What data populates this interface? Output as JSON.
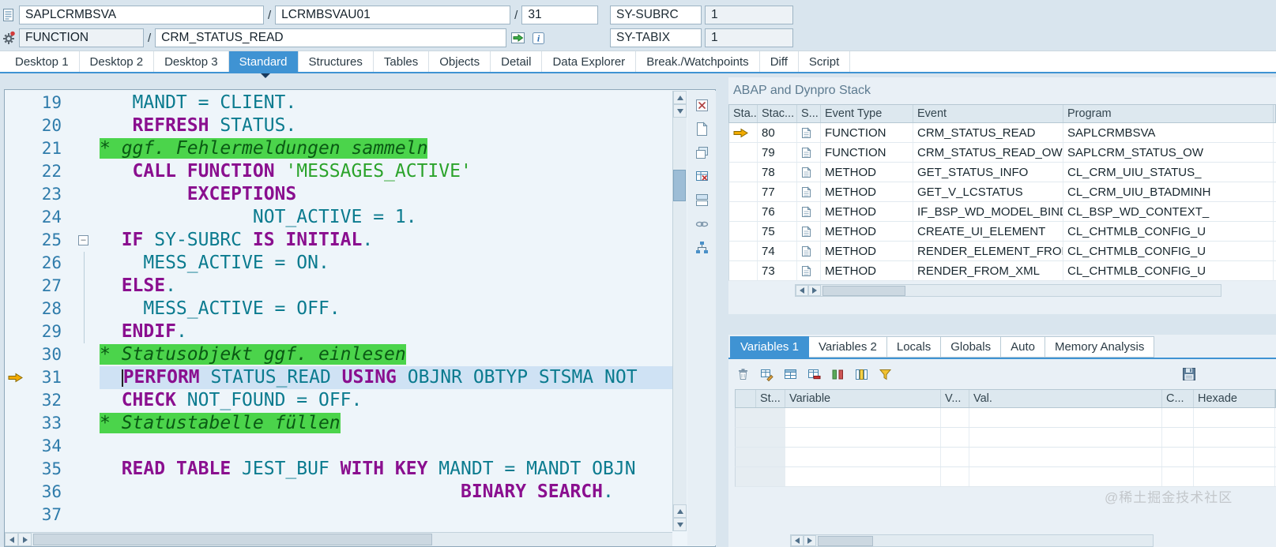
{
  "header": {
    "slash": "/",
    "main_program": "SAPLCRMBSVA",
    "include": "LCRMBSVAU01",
    "line_number": "31",
    "event_type": "FUNCTION",
    "event_name": "CRM_STATUS_READ",
    "sysvars": [
      {
        "label": "SY-SUBRC",
        "value": "1"
      },
      {
        "label": "SY-TABIX",
        "value": "1"
      }
    ]
  },
  "main_tabs": {
    "active": "Standard",
    "items": [
      "Desktop 1",
      "Desktop 2",
      "Desktop 3",
      "Standard",
      "Structures",
      "Tables",
      "Objects",
      "Detail",
      "Data Explorer",
      "Break./Watchpoints",
      "Diff",
      "Script"
    ]
  },
  "editor": {
    "tools": [
      "close-icon",
      "new-page-icon",
      "cascade-icon",
      "table-export-icon",
      "split-view-icon",
      "link-icon",
      "hierarchy-icon"
    ],
    "lines": [
      {
        "n": "19",
        "indent": 3,
        "tokens": [
          {
            "c": "id",
            "t": "MANDT = CLIENT."
          }
        ]
      },
      {
        "n": "20",
        "indent": 3,
        "tokens": [
          {
            "c": "kw",
            "t": "REFRESH"
          },
          {
            "c": "id",
            "t": " STATUS."
          }
        ]
      },
      {
        "n": "21",
        "indent": 0,
        "comment": "* ggf. Fehlermeldungen sammeln"
      },
      {
        "n": "22",
        "indent": 3,
        "tokens": [
          {
            "c": "kw",
            "t": "CALL FUNCTION"
          },
          {
            "c": "id",
            "t": " "
          },
          {
            "c": "str",
            "t": "'MESSAGES_ACTIVE'"
          }
        ]
      },
      {
        "n": "23",
        "indent": 8,
        "tokens": [
          {
            "c": "kw",
            "t": "EXCEPTIONS"
          }
        ]
      },
      {
        "n": "24",
        "indent": 14,
        "tokens": [
          {
            "c": "id",
            "t": "NOT_ACTIVE = 1."
          }
        ]
      },
      {
        "n": "25",
        "indent": 2,
        "fold": true,
        "tokens": [
          {
            "c": "kw",
            "t": "IF"
          },
          {
            "c": "id",
            "t": " SY-SUBRC "
          },
          {
            "c": "kw",
            "t": "IS INITIAL"
          },
          {
            "c": "id",
            "t": "."
          }
        ]
      },
      {
        "n": "26",
        "indent": 4,
        "foldline": true,
        "tokens": [
          {
            "c": "id",
            "t": "MESS_ACTIVE = ON."
          }
        ]
      },
      {
        "n": "27",
        "indent": 2,
        "foldline": true,
        "tokens": [
          {
            "c": "kw",
            "t": "ELSE"
          },
          {
            "c": "id",
            "t": "."
          }
        ]
      },
      {
        "n": "28",
        "indent": 4,
        "foldline": true,
        "tokens": [
          {
            "c": "id",
            "t": "MESS_ACTIVE = OFF."
          }
        ]
      },
      {
        "n": "29",
        "indent": 2,
        "foldline": true,
        "tokens": [
          {
            "c": "kw",
            "t": "ENDIF"
          },
          {
            "c": "id",
            "t": "."
          }
        ]
      },
      {
        "n": "30",
        "indent": 0,
        "comment": "* Statusobjekt ggf. einlesen"
      },
      {
        "n": "31",
        "indent": 2,
        "current": true,
        "arrow": true,
        "cursor": true,
        "tokens": [
          {
            "c": "kw",
            "t": "PERFORM"
          },
          {
            "c": "id",
            "t": " STATUS_READ "
          },
          {
            "c": "kw",
            "t": "USING"
          },
          {
            "c": "id",
            "t": " OBJNR OBTYP STSMA NOT"
          }
        ]
      },
      {
        "n": "32",
        "indent": 2,
        "tokens": [
          {
            "c": "kw",
            "t": "CHECK"
          },
          {
            "c": "id",
            "t": " NOT_FOUND = OFF."
          }
        ]
      },
      {
        "n": "33",
        "indent": 0,
        "comment": "* Statustabelle füllen"
      },
      {
        "n": "34",
        "indent": 0,
        "tokens": []
      },
      {
        "n": "35",
        "indent": 2,
        "tokens": [
          {
            "c": "kw",
            "t": "READ TABLE"
          },
          {
            "c": "id",
            "t": " JEST_BUF "
          },
          {
            "c": "kw",
            "t": "WITH KEY"
          },
          {
            "c": "id",
            "t": " MANDT = MANDT OBJN"
          }
        ]
      },
      {
        "n": "36",
        "indent": 33,
        "tokens": [
          {
            "c": "kw",
            "t": "BINARY SEARCH"
          },
          {
            "c": "id",
            "t": "."
          }
        ]
      },
      {
        "n": "37",
        "indent": 0,
        "tokens": []
      }
    ]
  },
  "stack": {
    "title": "ABAP and Dynpro Stack",
    "columns": [
      "Sta...",
      "Stac...",
      "S...",
      "Event Type",
      "Event",
      "Program"
    ],
    "rows": [
      {
        "current": true,
        "level": "80",
        "event_type": "FUNCTION",
        "event": "CRM_STATUS_READ",
        "program": "SAPLCRMBSVA"
      },
      {
        "current": false,
        "level": "79",
        "event_type": "FUNCTION",
        "event": "CRM_STATUS_READ_OW",
        "program": "SAPLCRM_STATUS_OW"
      },
      {
        "current": false,
        "level": "78",
        "event_type": "METHOD",
        "event": "GET_STATUS_INFO",
        "program": "CL_CRM_UIU_STATUS_"
      },
      {
        "current": false,
        "level": "77",
        "event_type": "METHOD",
        "event": "GET_V_LCSTATUS",
        "program": "CL_CRM_UIU_BTADMINH"
      },
      {
        "current": false,
        "level": "76",
        "event_type": "METHOD",
        "event": "IF_BSP_WD_MODEL_BINDI",
        "program": "CL_BSP_WD_CONTEXT_"
      },
      {
        "current": false,
        "level": "75",
        "event_type": "METHOD",
        "event": "CREATE_UI_ELEMENT",
        "program": "CL_CHTMLB_CONFIG_U"
      },
      {
        "current": false,
        "level": "74",
        "event_type": "METHOD",
        "event": "RENDER_ELEMENT_FROM_",
        "program": "CL_CHTMLB_CONFIG_U"
      },
      {
        "current": false,
        "level": "73",
        "event_type": "METHOD",
        "event": "RENDER_FROM_XML",
        "program": "CL_CHTMLB_CONFIG_U"
      }
    ]
  },
  "variables": {
    "active_tab": "Variables 1",
    "tabs": [
      "Variables 1",
      "Variables 2",
      "Locals",
      "Globals",
      "Auto",
      "Memory Analysis"
    ],
    "toolbar": [
      "delete-icon",
      "edit-table-icon",
      "table-settings-icon",
      "delete-selection-icon",
      "sort-columns-icon",
      "column-config-icon",
      "filter-icon"
    ],
    "save_icon": "save-icon",
    "columns": [
      "St...",
      "Variable",
      "V...",
      "Val.",
      "C...",
      "Hexade"
    ],
    "empty_row_count": 4
  },
  "watermark": "@稀土掘金技术社区"
}
